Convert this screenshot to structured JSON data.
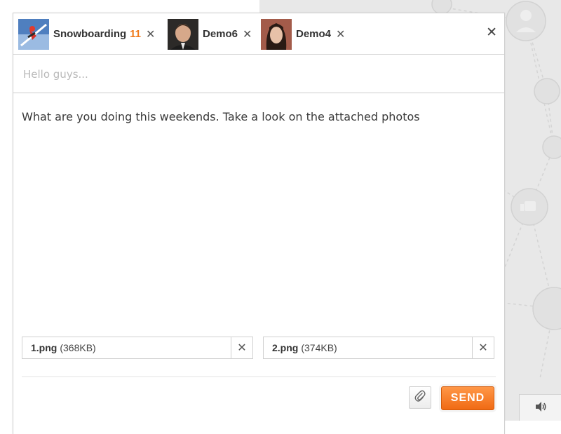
{
  "recipients": [
    {
      "name": "Snowboarding",
      "count": "11",
      "avatar_icon": "snowboarder-avatar"
    },
    {
      "name": "Demo6",
      "count": "",
      "avatar_icon": "man-avatar"
    },
    {
      "name": "Demo4",
      "count": "",
      "avatar_icon": "woman-avatar"
    }
  ],
  "subject": {
    "value": "",
    "placeholder": "Hello guys..."
  },
  "message": "What are you doing this weekends. Take a look on the attached photos",
  "attachments": [
    {
      "filename": "1.png",
      "size": "(368KB)"
    },
    {
      "filename": "2.png",
      "size": "(374KB)"
    }
  ],
  "actions": {
    "send_label": "SEND",
    "attach_icon": "paperclip-icon"
  },
  "sound_icon": "speaker-icon",
  "colors": {
    "accent": "#f07a1a",
    "send_bg": "#f57a24",
    "border": "#cfcfcf"
  }
}
